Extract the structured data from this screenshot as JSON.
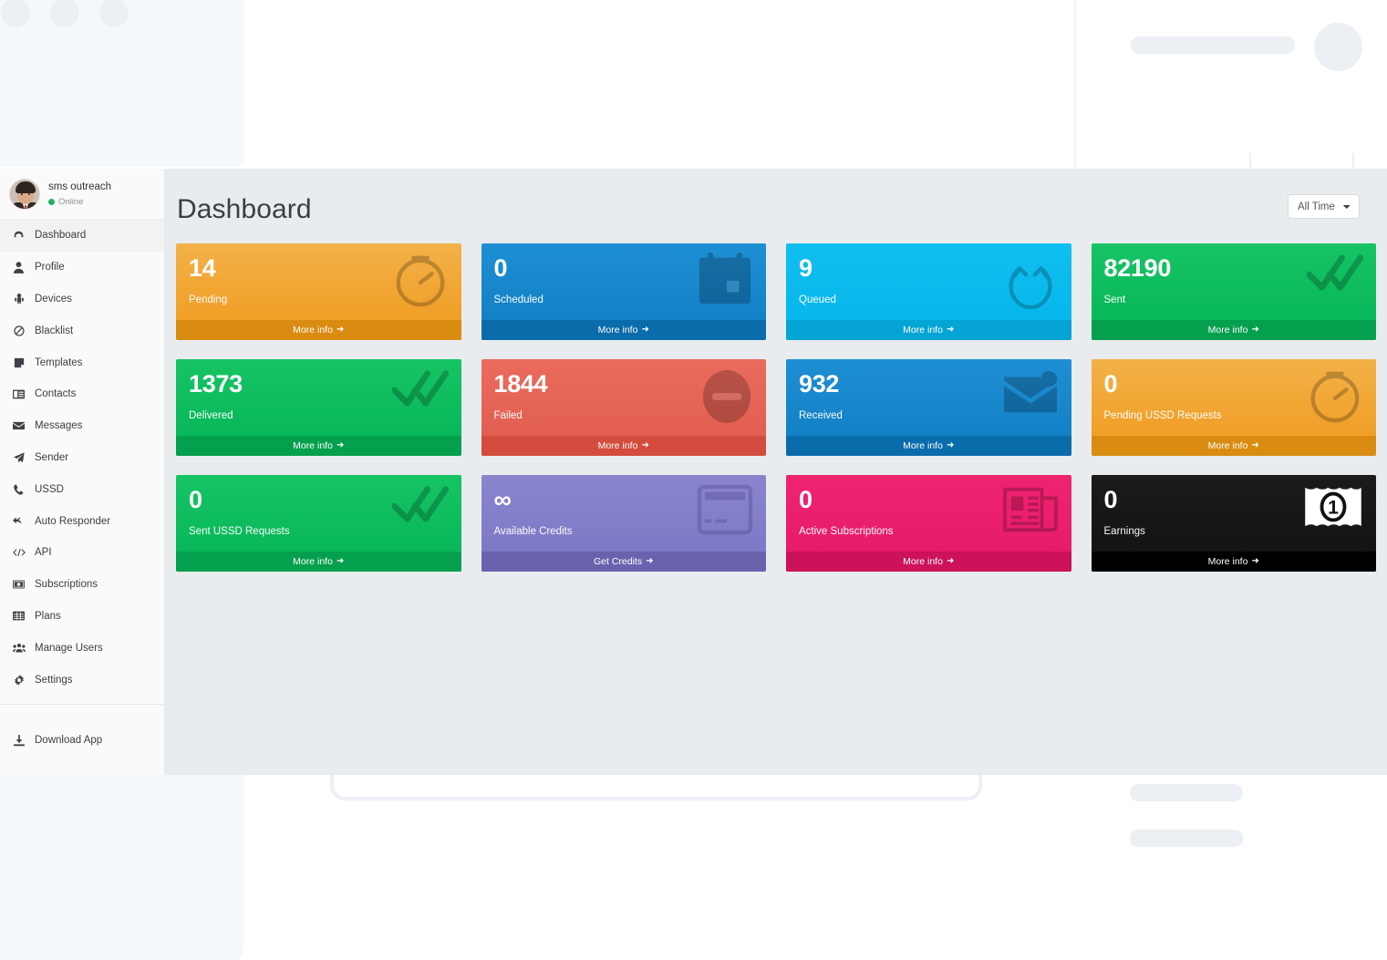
{
  "app": {
    "sidebar": {
      "user": {
        "name": "sms outreach",
        "status": "Online"
      },
      "items": [
        {
          "label": "Dashboard",
          "icon": "dashboard-icon",
          "active": true
        },
        {
          "label": "Profile",
          "icon": "user-icon",
          "active": false
        },
        {
          "label": "Devices",
          "icon": "android-icon",
          "active": false
        },
        {
          "label": "Blacklist",
          "icon": "ban-icon",
          "active": false
        },
        {
          "label": "Templates",
          "icon": "note-icon",
          "active": false
        },
        {
          "label": "Contacts",
          "icon": "address-book-icon",
          "active": false
        },
        {
          "label": "Messages",
          "icon": "envelope-icon",
          "active": false
        },
        {
          "label": "Sender",
          "icon": "paper-plane-icon",
          "active": false
        },
        {
          "label": "USSD",
          "icon": "phone-icon",
          "active": false
        },
        {
          "label": "Auto Responder",
          "icon": "reply-all-icon",
          "active": false
        },
        {
          "label": "API",
          "icon": "code-icon",
          "active": false
        },
        {
          "label": "Subscriptions",
          "icon": "money-icon",
          "active": false
        },
        {
          "label": "Plans",
          "icon": "table-icon",
          "active": false
        },
        {
          "label": "Manage Users",
          "icon": "users-icon",
          "active": false
        },
        {
          "label": "Settings",
          "icon": "gear-icon",
          "active": false
        }
      ],
      "bottom": [
        {
          "label": "Download App",
          "icon": "download-icon"
        }
      ]
    },
    "header": {
      "title": "Dashboard",
      "time_filter": {
        "selected": "All Time",
        "options": [
          "All Time"
        ]
      }
    },
    "cards": [
      {
        "value": "14",
        "label": "Pending",
        "footer": "More info",
        "theme": "c-orange",
        "icon": "stopwatch-icon"
      },
      {
        "value": "0",
        "label": "Scheduled",
        "footer": "More info",
        "theme": "c-blue",
        "icon": "calendar-icon"
      },
      {
        "value": "9",
        "label": "Queued",
        "footer": "More info",
        "theme": "c-cyan",
        "icon": "refresh-icon"
      },
      {
        "value": "82190",
        "label": "Sent",
        "footer": "More info",
        "theme": "c-green",
        "icon": "double-check-icon"
      },
      {
        "value": "1373",
        "label": "Delivered",
        "footer": "More info",
        "theme": "c-green",
        "icon": "double-check-icon"
      },
      {
        "value": "1844",
        "label": "Failed",
        "footer": "More info",
        "theme": "c-red",
        "icon": "minus-circle-icon"
      },
      {
        "value": "932",
        "label": "Received",
        "footer": "More info",
        "theme": "c-blue",
        "icon": "envelope-open-icon"
      },
      {
        "value": "0",
        "label": "Pending USSD Requests",
        "footer": "More info",
        "theme": "c-orange",
        "icon": "stopwatch-icon"
      },
      {
        "value": "0",
        "label": "Sent USSD Requests",
        "footer": "More info",
        "theme": "c-green",
        "icon": "double-check-icon"
      },
      {
        "value": "∞",
        "label": "Available Credits",
        "footer": "Get Credits",
        "theme": "c-purple",
        "icon": "credit-card-icon"
      },
      {
        "value": "0",
        "label": "Active Subscriptions",
        "footer": "More info",
        "theme": "c-pink",
        "icon": "newspaper-icon"
      },
      {
        "value": "0",
        "label": "Earnings",
        "footer": "More info",
        "theme": "c-black",
        "icon": "money-bill-icon"
      }
    ]
  },
  "colors": {
    "orange": "#ef9a1e",
    "blue": "#0f7dc2",
    "cyan": "#04b5ea",
    "green": "#05b457",
    "red": "#e05c4d",
    "purple": "#7b76c4",
    "pink": "#e51a66",
    "black": "#111111",
    "page_bg": "#e9ecef",
    "sidebar_bg": "#fafafa",
    "online": "#27ae60"
  }
}
